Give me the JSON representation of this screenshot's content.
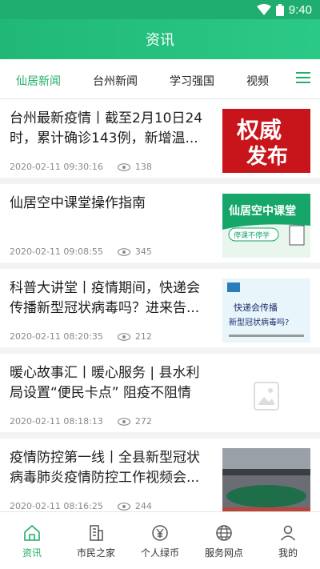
{
  "status_bar": {
    "time": "9:40"
  },
  "app_bar": {
    "title": "资讯"
  },
  "tabs": [
    {
      "label": "仙居新闻",
      "active": true
    },
    {
      "label": "台州新闻",
      "active": false
    },
    {
      "label": "学习强国",
      "active": false
    },
    {
      "label": "视频",
      "active": false
    }
  ],
  "news": [
    {
      "title": "台州最新疫情丨截至2月10日24时，累计确诊143例，新增温...",
      "date": "2020-02-11 09:30:16",
      "views": "138",
      "thumb_text": [
        "权威",
        "发布"
      ]
    },
    {
      "title": "仙居空中课堂操作指南",
      "date": "2020-02-11 09:08:55",
      "views": "345",
      "thumb_text": [
        "仙居空中课堂",
        "停课不停学"
      ]
    },
    {
      "title": "科普大讲堂丨疫情期间，快递会传播新型冠状病毒吗？进来告...",
      "date": "2020-02-11 08:20:35",
      "views": "212",
      "thumb_text": [
        "快递会传播",
        "新型冠状病毒吗?"
      ]
    },
    {
      "title": "暖心故事汇丨暖心服务 | 县水利局设置“便民卡点” 阻疫不阻情",
      "date": "2020-02-11 08:18:13",
      "views": "272",
      "thumb_text": []
    },
    {
      "title": "疫情防控第一线丨全县新型冠状病毒肺炎疫情防控工作视频会...",
      "date": "2020-02-11 08:16:25",
      "views": "244",
      "thumb_text": []
    }
  ],
  "bottom_nav": [
    {
      "label": "资讯",
      "icon": "home-icon",
      "active": true
    },
    {
      "label": "市民之家",
      "icon": "building-icon",
      "active": false
    },
    {
      "label": "个人绿币",
      "icon": "yuan-coin-icon",
      "active": false
    },
    {
      "label": "服务网点",
      "icon": "globe-icon",
      "active": false
    },
    {
      "label": "我的",
      "icon": "user-icon",
      "active": false
    }
  ],
  "colors": {
    "brand": "#21b069",
    "header_gradient_start": "#21b876",
    "header_gradient_end": "#2bc987"
  }
}
